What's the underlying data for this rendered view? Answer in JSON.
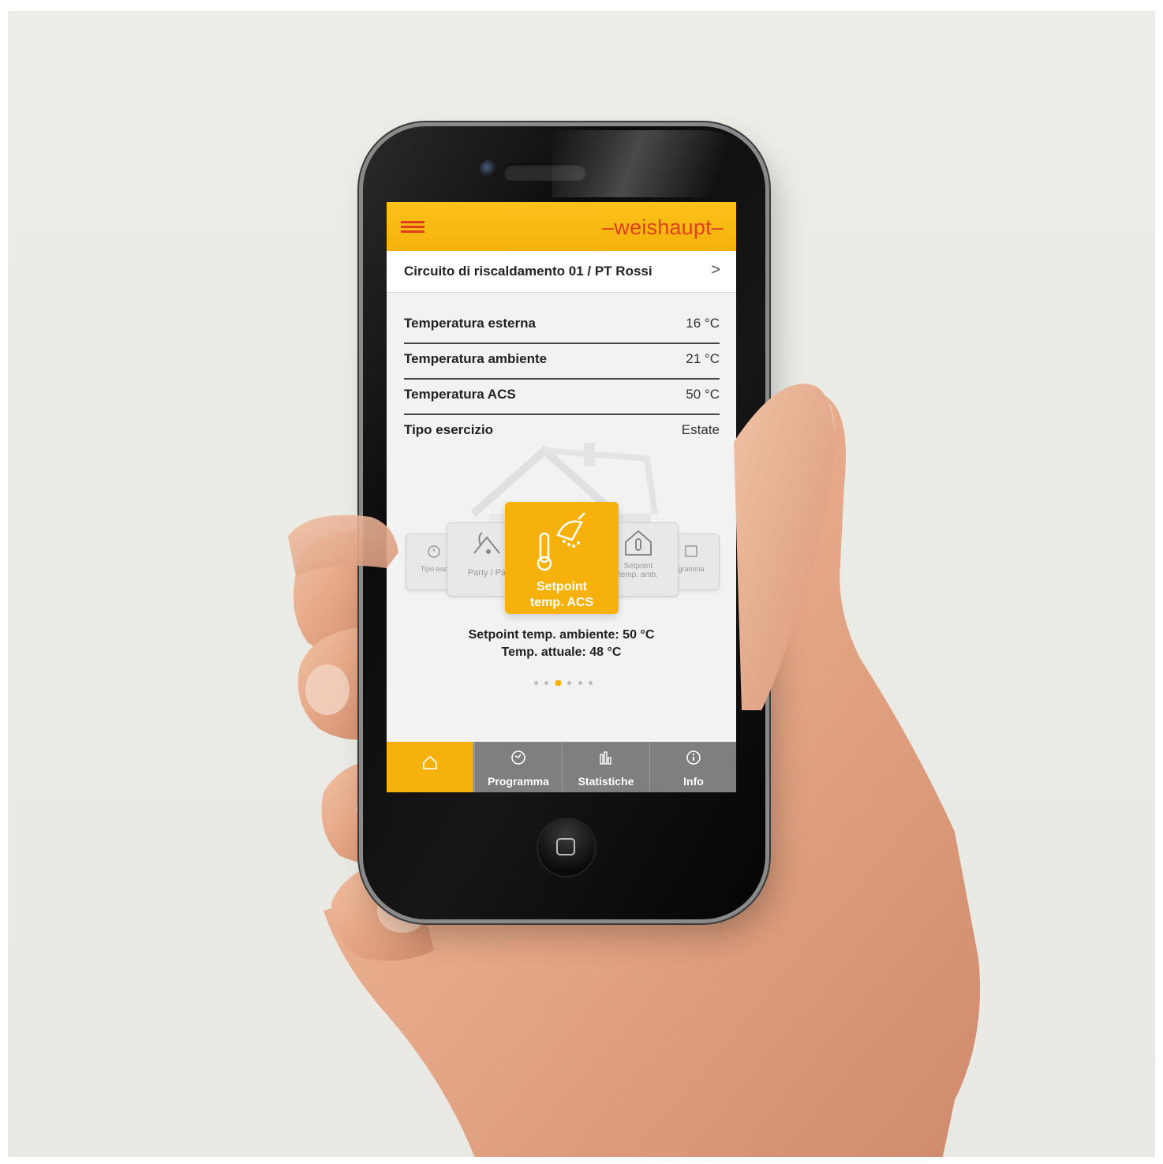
{
  "app": {
    "brand": "weishaupt",
    "brand_dash_left": "–",
    "brand_dash_right": "–",
    "colors": {
      "accent": "#f6b20b",
      "brand_red": "#e1401c",
      "tabbar": "#7f7f7f"
    }
  },
  "header": {
    "menu_icon": "hamburger-icon"
  },
  "circuit": {
    "label": "Circuito di riscaldamento 01 / PT Rossi",
    "arrow": ">"
  },
  "readings": [
    {
      "label": "Temperatura esterna",
      "value": "16 °C"
    },
    {
      "label": "Temperatura ambiente",
      "value": "21 °C"
    },
    {
      "label": "Temperatura ACS",
      "value": "50 °C"
    },
    {
      "label": "Tipo esercizio",
      "value": "Estate"
    }
  ],
  "carousel": {
    "tiles": [
      {
        "label": "Tipo ese",
        "icon": "timer-icon"
      },
      {
        "label": "Party / Pa",
        "icon": "party-icon"
      },
      {
        "label_line1": "Setpoint",
        "label_line2": "temp. ACS",
        "icon": "shower-thermometer-icon",
        "active": true
      },
      {
        "label_line1": "Setpoint",
        "label_line2": "temp. amb.",
        "icon": "house-thermometer-icon"
      },
      {
        "label": "gramma",
        "icon": "calendar-icon"
      }
    ]
  },
  "status": {
    "setpoint": "Setpoint temp. ambiente: 50 °C",
    "actual": "Temp. attuale: 48 °C"
  },
  "pager": {
    "count": 6,
    "active_index": 2
  },
  "tabs": [
    {
      "label": "",
      "icon": "home-icon",
      "active": true
    },
    {
      "label": "Programma",
      "icon": "clock-icon"
    },
    {
      "label": "Statistiche",
      "icon": "chart-icon"
    },
    {
      "label": "Info",
      "icon": "info-icon"
    }
  ]
}
